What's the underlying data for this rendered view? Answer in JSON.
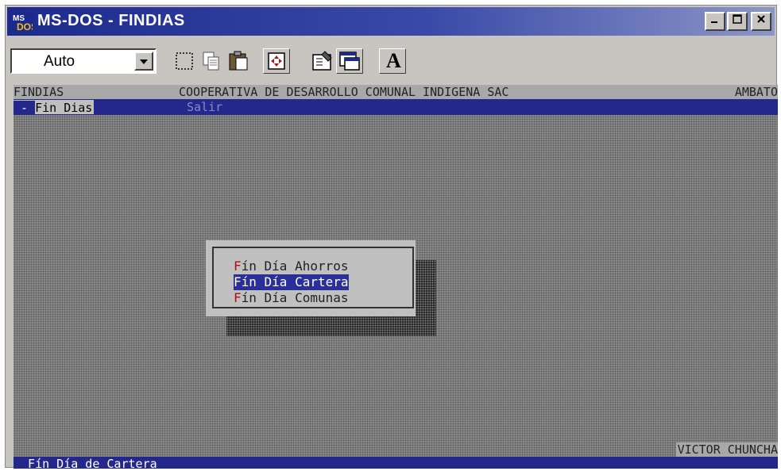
{
  "window": {
    "title": "MS-DOS - FINDIAS",
    "icon": "msdos-icon",
    "controls": [
      "minimize",
      "maximize",
      "close"
    ]
  },
  "toolbar": {
    "font_size_value": "Auto",
    "buttons": [
      "mark-icon",
      "copy-icon",
      "paste-icon",
      "fullscreen-icon",
      "properties-icon",
      "background-icon",
      "font-icon"
    ],
    "font_button_label": "A"
  },
  "dos": {
    "header": {
      "program": "FINDIAS",
      "institution": "COOPERATIVA DE DESARROLLO COMUNAL INDIGENA SAC",
      "branch": "AMBATO"
    },
    "menu": {
      "active_prefix": " - ",
      "active": "Fin Dias",
      "salir": "Salir"
    },
    "popup": {
      "items": [
        {
          "hot": "F",
          "rest": "ín Día Ahorros",
          "selected": false
        },
        {
          "hot": "F",
          "rest": "ín Día Cartera",
          "selected": true
        },
        {
          "hot": "F",
          "rest": "ín Día Comunas",
          "selected": false
        }
      ]
    },
    "user": "VICTOR CHUNCHA",
    "status": "  Fín Día de Cartera"
  },
  "colors": {
    "title_bar": "#1c2a8c",
    "dos_menu_bar": "#24288c",
    "selection": "#2a2f9a",
    "hotkey": "#b01010"
  }
}
